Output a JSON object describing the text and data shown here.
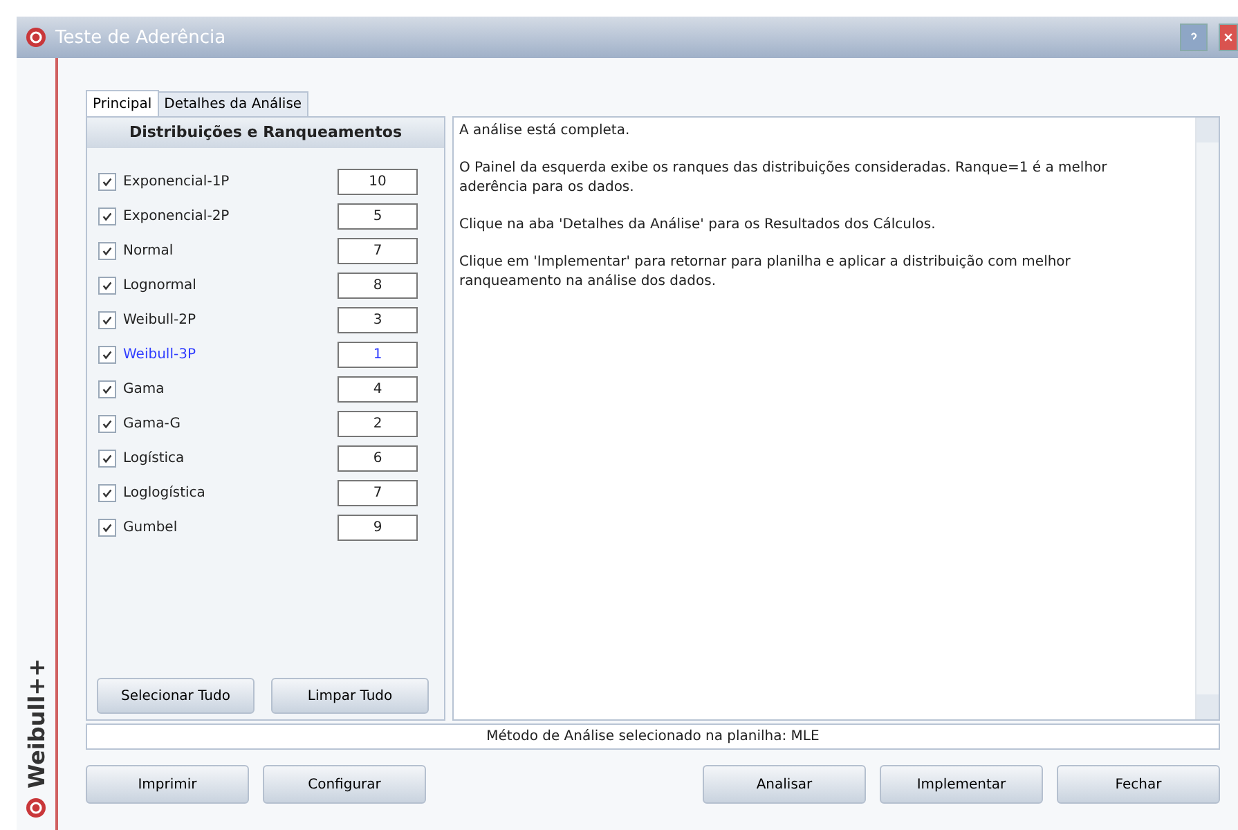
{
  "window": {
    "title": "Teste de Aderência",
    "side_label": "Weibull++"
  },
  "tabs": [
    {
      "label": "Principal",
      "selected": true
    },
    {
      "label": "Detalhes da Análise",
      "selected": false
    }
  ],
  "panel": {
    "title": "Distribuições e Ranqueamentos",
    "items": [
      {
        "name": "Exponencial-1P",
        "checked": true,
        "rank": "10",
        "highlighted": false
      },
      {
        "name": "Exponencial-2P",
        "checked": true,
        "rank": "5",
        "highlighted": false
      },
      {
        "name": "Normal",
        "checked": true,
        "rank": "7",
        "highlighted": false
      },
      {
        "name": "Lognormal",
        "checked": true,
        "rank": "8",
        "highlighted": false
      },
      {
        "name": "Weibull-2P",
        "checked": true,
        "rank": "3",
        "highlighted": false
      },
      {
        "name": "Weibull-3P",
        "checked": true,
        "rank": "1",
        "highlighted": true
      },
      {
        "name": "Gama",
        "checked": true,
        "rank": "4",
        "highlighted": false
      },
      {
        "name": "Gama-G",
        "checked": true,
        "rank": "2",
        "highlighted": false
      },
      {
        "name": "Logística",
        "checked": true,
        "rank": "6",
        "highlighted": false
      },
      {
        "name": "Loglogística",
        "checked": true,
        "rank": "7",
        "highlighted": false
      },
      {
        "name": "Gumbel",
        "checked": true,
        "rank": "9",
        "highlighted": false
      }
    ],
    "buttons": [
      "Selecionar Tudo",
      "Limpar Tudo"
    ]
  },
  "message": [
    "A análise está completa.",
    "O Painel da esquerda exibe os ranques das distribuições consideradas. Ranque=1 é a melhor aderência para os dados.",
    "Clique na aba 'Detalhes da Análise' para os Resultados dos Cálculos.",
    "Clique em 'Implementar' para retornar para planilha e aplicar a distribuição com melhor ranqueamento na análise dos dados."
  ],
  "status_bar": "Método de Análise selecionado na planilha: MLE",
  "left_buttons": [
    "Imprimir",
    "Configurar"
  ],
  "right_buttons": [
    "Analisar",
    "Implementar",
    "Fechar"
  ]
}
